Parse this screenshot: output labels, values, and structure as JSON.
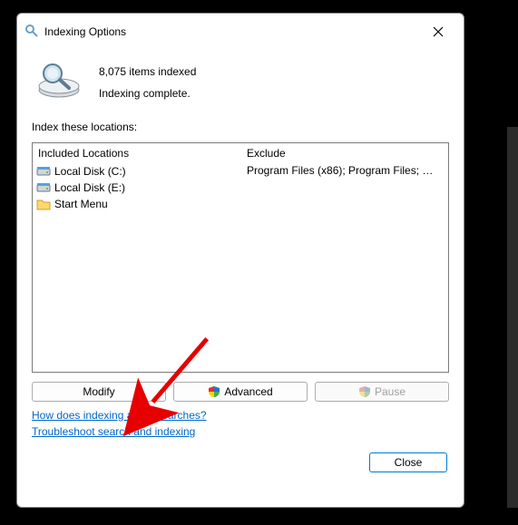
{
  "titlebar": {
    "title": "Indexing Options"
  },
  "status": {
    "count_line": "8,075 items indexed",
    "state_line": "Indexing complete."
  },
  "locations_label": "Index these locations:",
  "columns": {
    "included": "Included Locations",
    "exclude": "Exclude"
  },
  "included": [
    {
      "icon": "disk",
      "label": "Local Disk (C:)"
    },
    {
      "icon": "disk",
      "label": "Local Disk (E:)"
    },
    {
      "icon": "folder",
      "label": "Start Menu"
    }
  ],
  "excluded": [
    "Program Files (x86); Program Files; Progra..."
  ],
  "buttons": {
    "modify": "Modify",
    "advanced": "Advanced",
    "pause": "Pause",
    "close": "Close"
  },
  "links": {
    "how": "How does indexing affect searches?",
    "troubleshoot": "Troubleshoot search and indexing"
  }
}
